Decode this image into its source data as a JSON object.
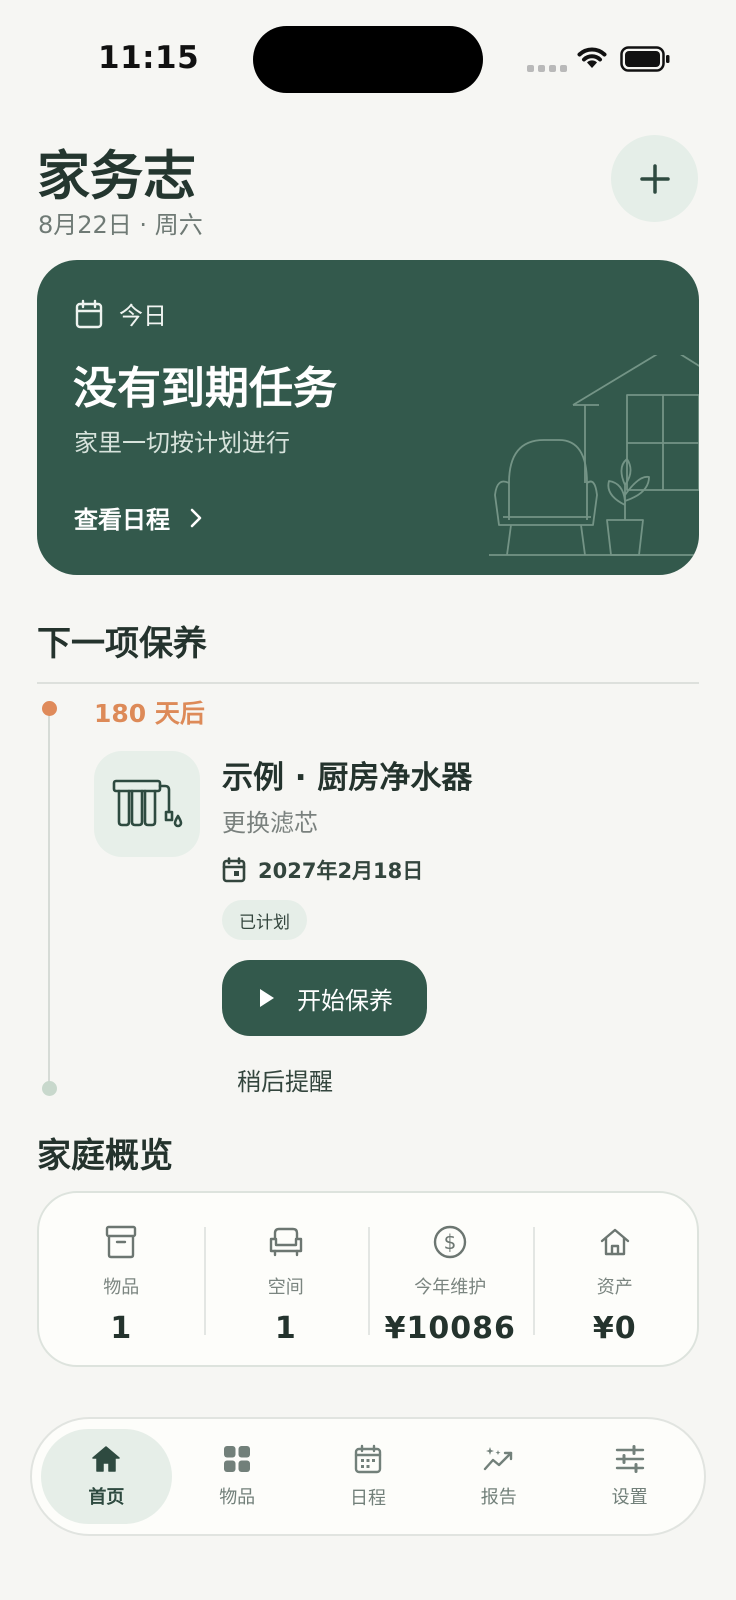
{
  "status_bar": {
    "time": "11:15"
  },
  "header": {
    "title": "家务志",
    "date": "8月22日 · 周六",
    "add_icon": "plus-icon"
  },
  "today_card": {
    "label": "今日",
    "headline": "没有到期任务",
    "subtitle": "家里一切按计划进行",
    "link_label": "查看日程"
  },
  "next_maintenance": {
    "section_title": "下一项保养",
    "due_in": "180 天后",
    "item_name": "示例 · 厨房净水器",
    "task": "更换滤芯",
    "date": "2027年2月18日",
    "status": "已计划",
    "start_label": "开始保养",
    "later_label": "稍后提醒"
  },
  "overview": {
    "section_title": "家庭概览",
    "stats": [
      {
        "label": "物品",
        "value": "1",
        "icon": "archive-box-icon"
      },
      {
        "label": "空间",
        "value": "1",
        "icon": "sofa-icon"
      },
      {
        "label": "今年维护",
        "value": "¥10086",
        "icon": "dollar-circle-icon"
      },
      {
        "label": "资产",
        "value": "¥0",
        "icon": "house-icon"
      }
    ]
  },
  "tab_bar": {
    "tabs": [
      {
        "label": "首页",
        "icon": "home-icon",
        "active": true
      },
      {
        "label": "物品",
        "icon": "grid-icon",
        "active": false
      },
      {
        "label": "日程",
        "icon": "calendar-icon",
        "active": false
      },
      {
        "label": "报告",
        "icon": "chart-sparkle-icon",
        "active": false
      },
      {
        "label": "设置",
        "icon": "sliders-icon",
        "active": false
      }
    ]
  },
  "colors": {
    "primary": "#33594c",
    "accent": "#df8a5a",
    "background": "#f6f6f3"
  }
}
